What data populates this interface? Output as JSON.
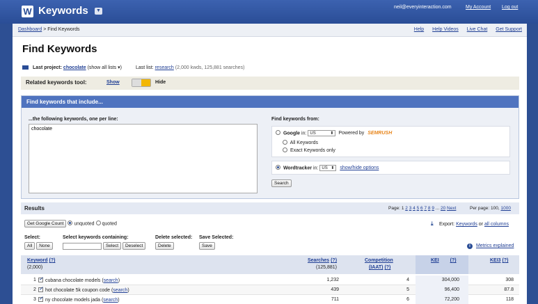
{
  "app": {
    "logo_letter": "W",
    "title": "Keywords",
    "dropdown_glyph": "▼"
  },
  "top": {
    "email": "neil@everyinteraction.com",
    "my_account": "My Account",
    "logout": "Log out"
  },
  "nav": {
    "breadcrumb_home": "Dashboard",
    "breadcrumb_sep": ">",
    "breadcrumb_current": "Find Keywords",
    "help": "Help",
    "help_videos": "Help Videos",
    "live_chat": "Live Chat",
    "get_support": "Get Support"
  },
  "page_title": "Find Keywords",
  "project": {
    "label": "Last project:",
    "name": "chocolate",
    "show_all": "(show all lists",
    "show_all_close": ")",
    "last_list_label": "Last list:",
    "last_list_name": "research",
    "last_list_stats": "(2,000 kwds, 125,881 searches)"
  },
  "related": {
    "label": "Related keywords tool:",
    "show": "Show",
    "hide": "Hide"
  },
  "find_panel": {
    "header": "Find keywords that include...",
    "left_label": "...the following keywords, one per line:",
    "keywords_value": "chocolate",
    "right_label": "Find keywords from:",
    "google_label": "Google",
    "in_label": "in:",
    "google_country": "US",
    "powered_by": "Powered by",
    "semrush": "SEMRUSH",
    "all_keywords": "All Keywords",
    "exact_keywords": "Exact Keywords only",
    "wordtracker_label": "Wordtracker",
    "wordtracker_country": "US",
    "show_hide_options": "show/hide options",
    "search_button": "Search"
  },
  "results": {
    "title": "Results",
    "page_label": "Page:",
    "pages": [
      "1",
      "2",
      "3",
      "4",
      "5",
      "6",
      "7",
      "8",
      "9"
    ],
    "ellipsis": "...",
    "last_page": "20",
    "next": "Next",
    "per_page_label": "Per page: 100,",
    "per_page_alt": "1000",
    "get_google_count": "Get Google Count",
    "unquoted": "unquoted",
    "quoted": "quoted",
    "export_label": "Export:",
    "export_keywords": "Keywords",
    "export_or": "or",
    "export_all": "all columns",
    "select_label": "Select:",
    "all_button": "All",
    "none_button": "None",
    "select_containing_label": "Select keywords containing:",
    "select_button": "Select",
    "deselect_button": "Deselect",
    "delete_selected_label": "Delete selected:",
    "delete_button": "Delete",
    "save_selected_label": "Save Selected:",
    "save_button": "Save",
    "metrics_explained": "Metrics explained"
  },
  "table": {
    "headers": {
      "keyword": "Keyword",
      "keyword_count": "(2,000)",
      "searches": "Searches",
      "searches_total": "(125,881)",
      "competition": "Competition",
      "iaat": "(IAAT)",
      "kei": "KEI",
      "kei3": "KEI3",
      "help_mark": "(?)"
    },
    "search_link": "search",
    "rows": [
      {
        "n": "1",
        "keyword": "cubana chocolate models",
        "searches": "1,232",
        "competition": "4",
        "kei": "304,000",
        "kei3": "308"
      },
      {
        "n": "2",
        "keyword": "hot chocolate 5k coupon code",
        "searches": "439",
        "competition": "5",
        "kei": "96,400",
        "kei3": "87.8"
      },
      {
        "n": "3",
        "keyword": "ny chocolate models jada",
        "searches": "711",
        "competition": "6",
        "kei": "72,200",
        "kei3": "118"
      }
    ]
  }
}
